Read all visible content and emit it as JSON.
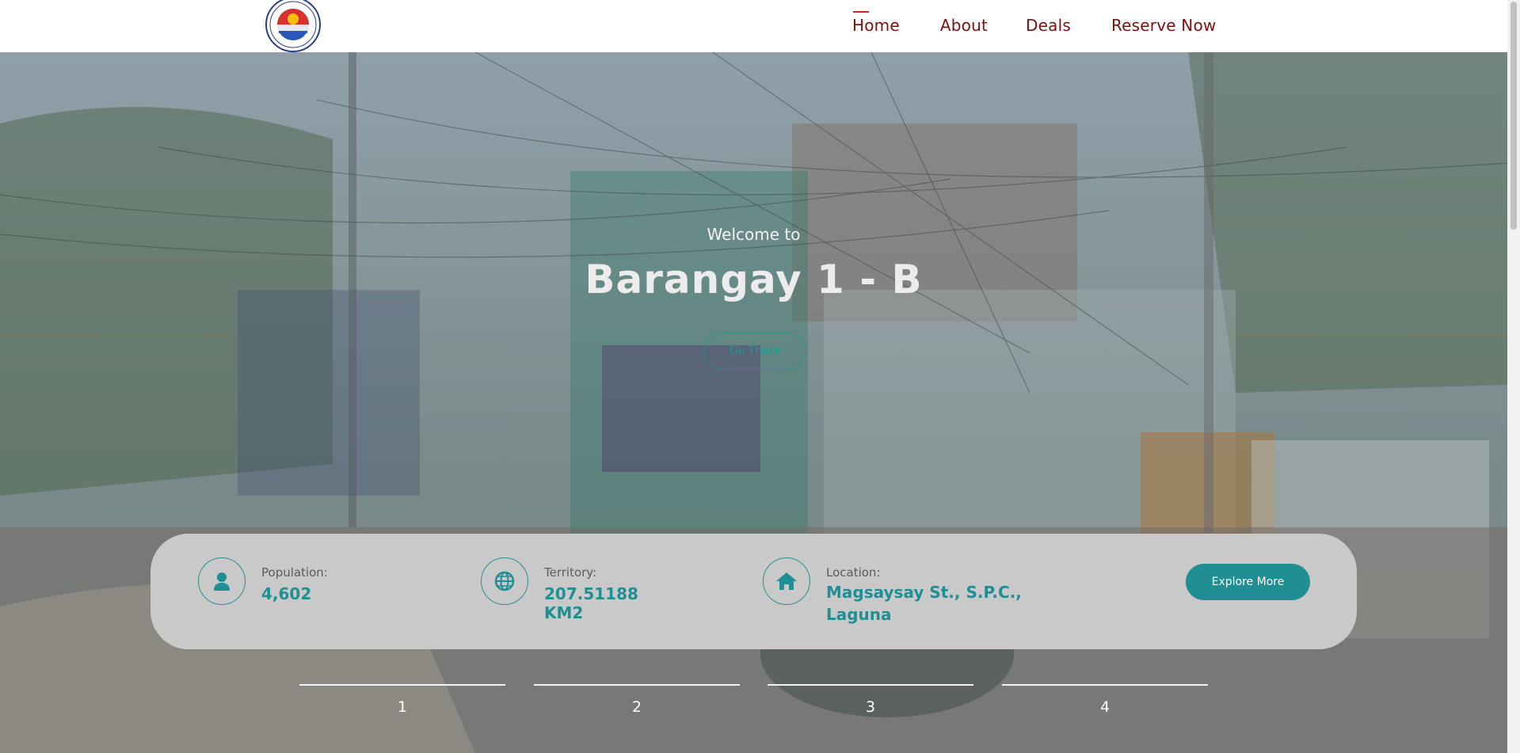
{
  "header": {
    "nav": [
      {
        "label": "Home",
        "active": true
      },
      {
        "label": "About",
        "active": false
      },
      {
        "label": "Deals",
        "active": false
      },
      {
        "label": "Reserve Now",
        "active": false
      }
    ],
    "nav_color": "#7a1010"
  },
  "hero": {
    "welcome": "Welcome to",
    "title": "Barangay 1 - B",
    "cta": "Go There"
  },
  "stats": {
    "items": [
      {
        "icon": "user-icon",
        "label": "Population:",
        "value": "4,602"
      },
      {
        "icon": "globe-icon",
        "label": "Territory:",
        "value": "207.51188 KM2"
      },
      {
        "icon": "home-icon",
        "label": "Location:",
        "value": "Magsaysay St., S.P.C., Laguna"
      }
    ],
    "explore_label": "Explore More",
    "accent": "#1f8f93"
  },
  "pager": [
    "1",
    "2",
    "3",
    "4"
  ]
}
